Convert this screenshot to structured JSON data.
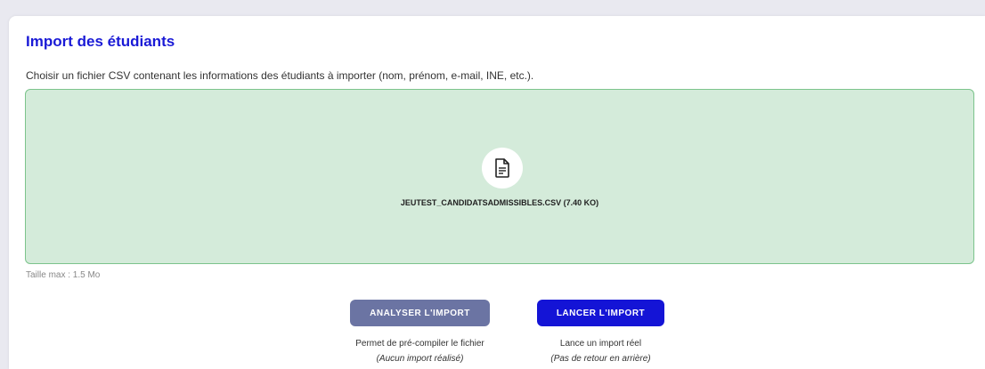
{
  "header": {
    "title": "Import des étudiants"
  },
  "description": "Choisir un fichier CSV contenant les informations des étudiants à importer (nom, prénom, e-mail, INE, etc.).",
  "dropzone": {
    "file_name": "JEUTEST_CANDIDATSADMISSIBLES.CSV (7.40 KO)",
    "icon": "document-icon"
  },
  "max_size": "Taille max : 1.5 Mo",
  "actions": {
    "analyze": {
      "label": "ANALYSER L'IMPORT",
      "note": "Permet de pré-compiler le fichier",
      "subnote": "(Aucun import réalisé)"
    },
    "launch": {
      "label": "LANCER L'IMPORT",
      "note": "Lance un import réel",
      "subnote": "(Pas de retour en arrière)"
    }
  },
  "colors": {
    "accent": "#1414d6",
    "title": "#1a1ad6",
    "dropzone_bg": "#d4ebda",
    "dropzone_border": "#7cc48c",
    "secondary_button": "#6b74a3"
  }
}
